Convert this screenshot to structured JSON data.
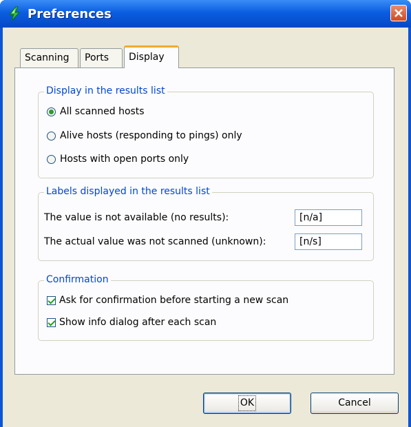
{
  "window": {
    "title": "Preferences"
  },
  "tabs": [
    {
      "label": "Scanning",
      "active": false
    },
    {
      "label": "Ports",
      "active": false
    },
    {
      "label": "Display",
      "active": true
    }
  ],
  "display_group": {
    "title": "Display in the results list",
    "options": [
      {
        "label": "All scanned hosts",
        "selected": true
      },
      {
        "label": "Alive hosts (responding to pings) only",
        "selected": false
      },
      {
        "label": "Hosts with open ports only",
        "selected": false
      }
    ]
  },
  "labels_group": {
    "title": "Labels displayed in the results list",
    "not_available_label": "The value is not available (no results):",
    "not_available_value": "[n/a]",
    "not_scanned_label": "The actual value was not scanned (unknown):",
    "not_scanned_value": "[n/s]"
  },
  "confirmation_group": {
    "title": "Confirmation",
    "ask_confirmation_label": "Ask for confirmation before starting a new scan",
    "ask_confirmation_checked": true,
    "show_info_label": "Show info dialog after each scan",
    "show_info_checked": true
  },
  "buttons": {
    "ok": "OK",
    "cancel": "Cancel"
  },
  "colors": {
    "title_bar": "#0a5ee0",
    "group_title": "#0046d5",
    "active_tab_accent": "#f2a930",
    "close_button": "#cf4a22"
  }
}
